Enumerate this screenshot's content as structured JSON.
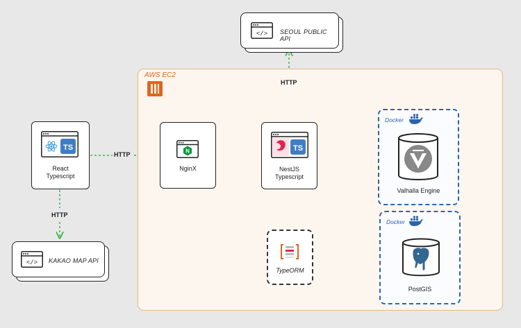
{
  "ec2": {
    "label": "AWS EC2"
  },
  "apis": {
    "seoul": "SEOUL PUBLIC API",
    "kakao": "KAKAO MAP API"
  },
  "nodes": {
    "react": {
      "line1": "React",
      "line2": "Typescript"
    },
    "nginx": {
      "label": "NginX"
    },
    "nest": {
      "line1": "NestJS",
      "line2": "Typescript"
    },
    "typeorm": {
      "label": "TypeORM"
    },
    "valhalla": {
      "label": "Valhalla Engine"
    },
    "postgis": {
      "label": "PostGIS"
    }
  },
  "edges": {
    "http_react_nginx": "HTTP",
    "http_react_kakao": "HTTP",
    "http_nest_seoul": "HTTP"
  },
  "docker": {
    "label1": "Docker",
    "label2": "Docker"
  },
  "icons": {
    "ts": "TS"
  },
  "colors": {
    "http_arrow": "#3bb54a",
    "internal_arrow": "#7ea7e6",
    "docker": "#2a63b0",
    "ec2": "#e0651b",
    "ts": "#3f7ec4",
    "nest": "#e0234e",
    "nginx": "#009639"
  }
}
